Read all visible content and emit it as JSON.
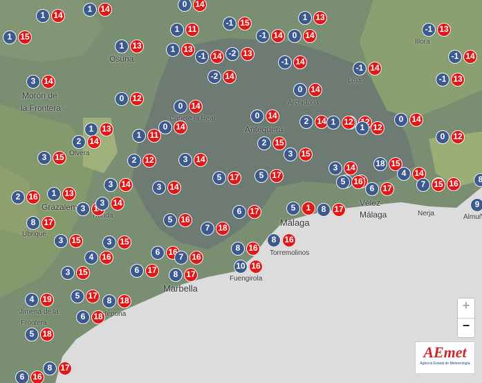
{
  "map": {
    "colors": {
      "sea": "#dcdcdc",
      "land": "#7a8f72",
      "inland": "#6d7b73",
      "min_badge": "#3c5a8e",
      "max_badge": "#e01818"
    },
    "towns": [
      {
        "name": "Osuna"
      },
      {
        "name": "Morón de"
      },
      {
        "name": "la Frontera"
      },
      {
        "name": "Cañete la Real"
      },
      {
        "name": "Antequera"
      },
      {
        "name": "Archidona"
      },
      {
        "name": "Loja"
      },
      {
        "name": "Íllora"
      },
      {
        "name": "Olvera"
      },
      {
        "name": "Grazalema"
      },
      {
        "name": "Ronda"
      },
      {
        "name": "Ubrique"
      },
      {
        "name": "Málaga"
      },
      {
        "name": "Vélez-"
      },
      {
        "name": "Málaga"
      },
      {
        "name": "Nerja"
      },
      {
        "name": "Almuñécar"
      },
      {
        "name": "Marbella"
      },
      {
        "name": "Fuengirola"
      },
      {
        "name": "Torremolinos"
      },
      {
        "name": "Jimena de la"
      },
      {
        "name": "Frontera"
      },
      {
        "name": "Estepona"
      }
    ],
    "stations": [
      {
        "min": "1",
        "max": "14"
      },
      {
        "min": "1",
        "max": "14"
      },
      {
        "min": "0",
        "max": "14"
      },
      {
        "min": "1",
        "max": "15"
      },
      {
        "min": "1",
        "max": "11"
      },
      {
        "min": "-1",
        "max": "15"
      },
      {
        "min": "1",
        "max": "13"
      },
      {
        "min": "-1",
        "max": "14"
      },
      {
        "min": "0",
        "max": "14"
      },
      {
        "min": "-1",
        "max": "13"
      },
      {
        "min": "1",
        "max": "13"
      },
      {
        "min": "1",
        "max": "13"
      },
      {
        "min": "-1",
        "max": "14"
      },
      {
        "min": "-2",
        "max": "13"
      },
      {
        "min": "-1",
        "max": "14"
      },
      {
        "min": "-1",
        "max": "14"
      },
      {
        "min": "-2",
        "max": "14"
      },
      {
        "min": "-1",
        "max": "14"
      },
      {
        "min": "-1",
        "max": "13"
      },
      {
        "min": "3",
        "max": "14"
      },
      {
        "min": "0",
        "max": "14"
      },
      {
        "min": "0",
        "max": "12"
      },
      {
        "min": "0",
        "max": "14"
      },
      {
        "min": "0",
        "max": "14"
      },
      {
        "min": "0",
        "max": "14"
      },
      {
        "min": "1",
        "max": "13"
      },
      {
        "min": "2",
        "max": "14"
      },
      {
        "min": "0",
        "max": "14"
      },
      {
        "min": "1",
        "max": "11"
      },
      {
        "min": "2",
        "max": "14"
      },
      {
        "min": "2",
        "max": "12"
      },
      {
        "min": "1",
        "max": "12"
      },
      {
        "min": "0",
        "max": "12"
      },
      {
        "min": "2",
        "max": "15"
      },
      {
        "min": "1",
        "max": "12"
      },
      {
        "min": "3",
        "max": "15"
      },
      {
        "min": "2",
        "max": "12"
      },
      {
        "min": "3",
        "max": "14"
      },
      {
        "min": "3",
        "max": "15"
      },
      {
        "min": "3",
        "max": "14"
      },
      {
        "min": "3",
        "max": "14"
      },
      {
        "min": "18",
        "max": "15"
      },
      {
        "min": "3",
        "max": "14"
      },
      {
        "min": "4",
        "max": "14"
      },
      {
        "min": "2",
        "max": "16"
      },
      {
        "min": "1",
        "max": "13"
      },
      {
        "min": "3",
        "max": "14"
      },
      {
        "min": "3",
        "max": "14"
      },
      {
        "min": "3",
        "max": "14"
      },
      {
        "min": "5",
        "max": "17"
      },
      {
        "min": "5",
        "max": "17"
      },
      {
        "min": "5",
        "max": "16"
      },
      {
        "min": "6",
        "max": "17"
      },
      {
        "min": "3",
        "max": "16"
      },
      {
        "min": "7",
        "max": "15"
      },
      {
        "min": "8",
        "max": "15"
      },
      {
        "min": "5",
        "max": "1"
      },
      {
        "min": "8",
        "max": "17"
      },
      {
        "min": "8",
        "max": "17"
      },
      {
        "min": "5",
        "max": "16"
      },
      {
        "min": "6",
        "max": "17"
      },
      {
        "min": "7",
        "max": "18"
      },
      {
        "min": "3",
        "max": "15"
      },
      {
        "min": "3",
        "max": "15"
      },
      {
        "min": "8",
        "max": "16"
      },
      {
        "min": "8",
        "max": "16"
      },
      {
        "min": "6",
        "max": "16"
      },
      {
        "min": "4",
        "max": "16"
      },
      {
        "min": "7",
        "max": "16"
      },
      {
        "min": "10",
        "max": "16"
      },
      {
        "min": "3",
        "max": "15"
      },
      {
        "min": "6",
        "max": "17"
      },
      {
        "min": "8",
        "max": "17"
      },
      {
        "min": "4",
        "max": "19"
      },
      {
        "min": "5",
        "max": "17"
      },
      {
        "min": "8",
        "max": "18"
      },
      {
        "min": "6",
        "max": "18"
      },
      {
        "min": "5",
        "max": "18"
      },
      {
        "min": "6",
        "max": "16"
      },
      {
        "min": "8",
        "max": "17"
      },
      {
        "min": "9",
        "max": ""
      }
    ],
    "zoom": {
      "in": "+",
      "out": "−"
    },
    "logo": {
      "text": "AEmet",
      "subtitle": "Agencia Estatal de Meteorología"
    }
  }
}
